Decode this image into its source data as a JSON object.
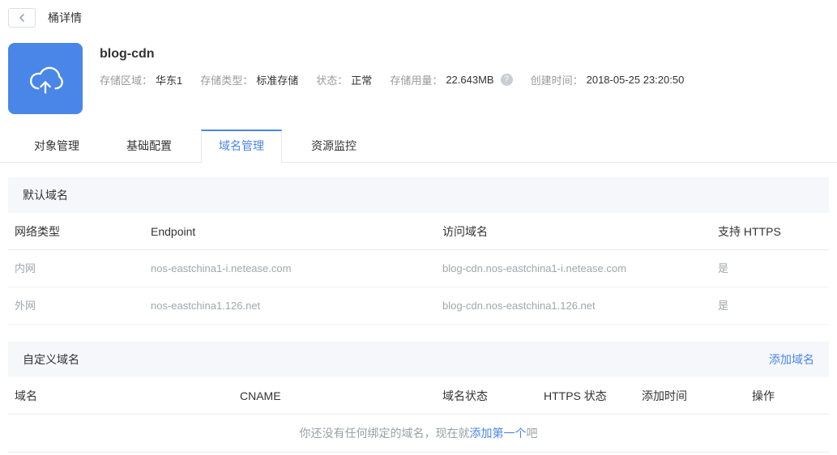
{
  "topbar": {
    "title": "桶详情"
  },
  "bucket": {
    "name": "blog-cdn",
    "meta": [
      {
        "label": "存储区域：",
        "value": "华东1"
      },
      {
        "label": "存储类型：",
        "value": "标准存储"
      },
      {
        "label": "状态：",
        "value": "正常"
      },
      {
        "label": "存储用量：",
        "value": "22.643MB"
      },
      {
        "label": "创建时间：",
        "value": "2018-05-25 23:20:50"
      }
    ],
    "help_icon": "?"
  },
  "tabs": [
    {
      "label": "对象管理",
      "active": false
    },
    {
      "label": "基础配置",
      "active": false
    },
    {
      "label": "域名管理",
      "active": true
    },
    {
      "label": "资源监控",
      "active": false
    }
  ],
  "default_domains": {
    "section_title": "默认域名",
    "columns": [
      "网络类型",
      "Endpoint",
      "访问域名",
      "支持 HTTPS"
    ],
    "rows": [
      [
        "内网",
        "nos-eastchina1-i.netease.com",
        "blog-cdn.nos-eastchina1-i.netease.com",
        "是"
      ],
      [
        "外网",
        "nos-eastchina1.126.net",
        "blog-cdn.nos-eastchina1.126.net",
        "是"
      ]
    ]
  },
  "custom_domains": {
    "section_title": "自定义域名",
    "add_link": "添加域名",
    "columns": [
      "域名",
      "CNAME",
      "域名状态",
      "HTTPS 状态",
      "添加时间",
      "操作"
    ],
    "empty": {
      "prefix": "你还没有任何绑定的域名，现在就",
      "link": "添加第一个",
      "suffix": "吧"
    }
  },
  "colors": {
    "accent": "#4a86e8",
    "section_bg": "#f5f7fa",
    "muted_text": "#999999"
  }
}
